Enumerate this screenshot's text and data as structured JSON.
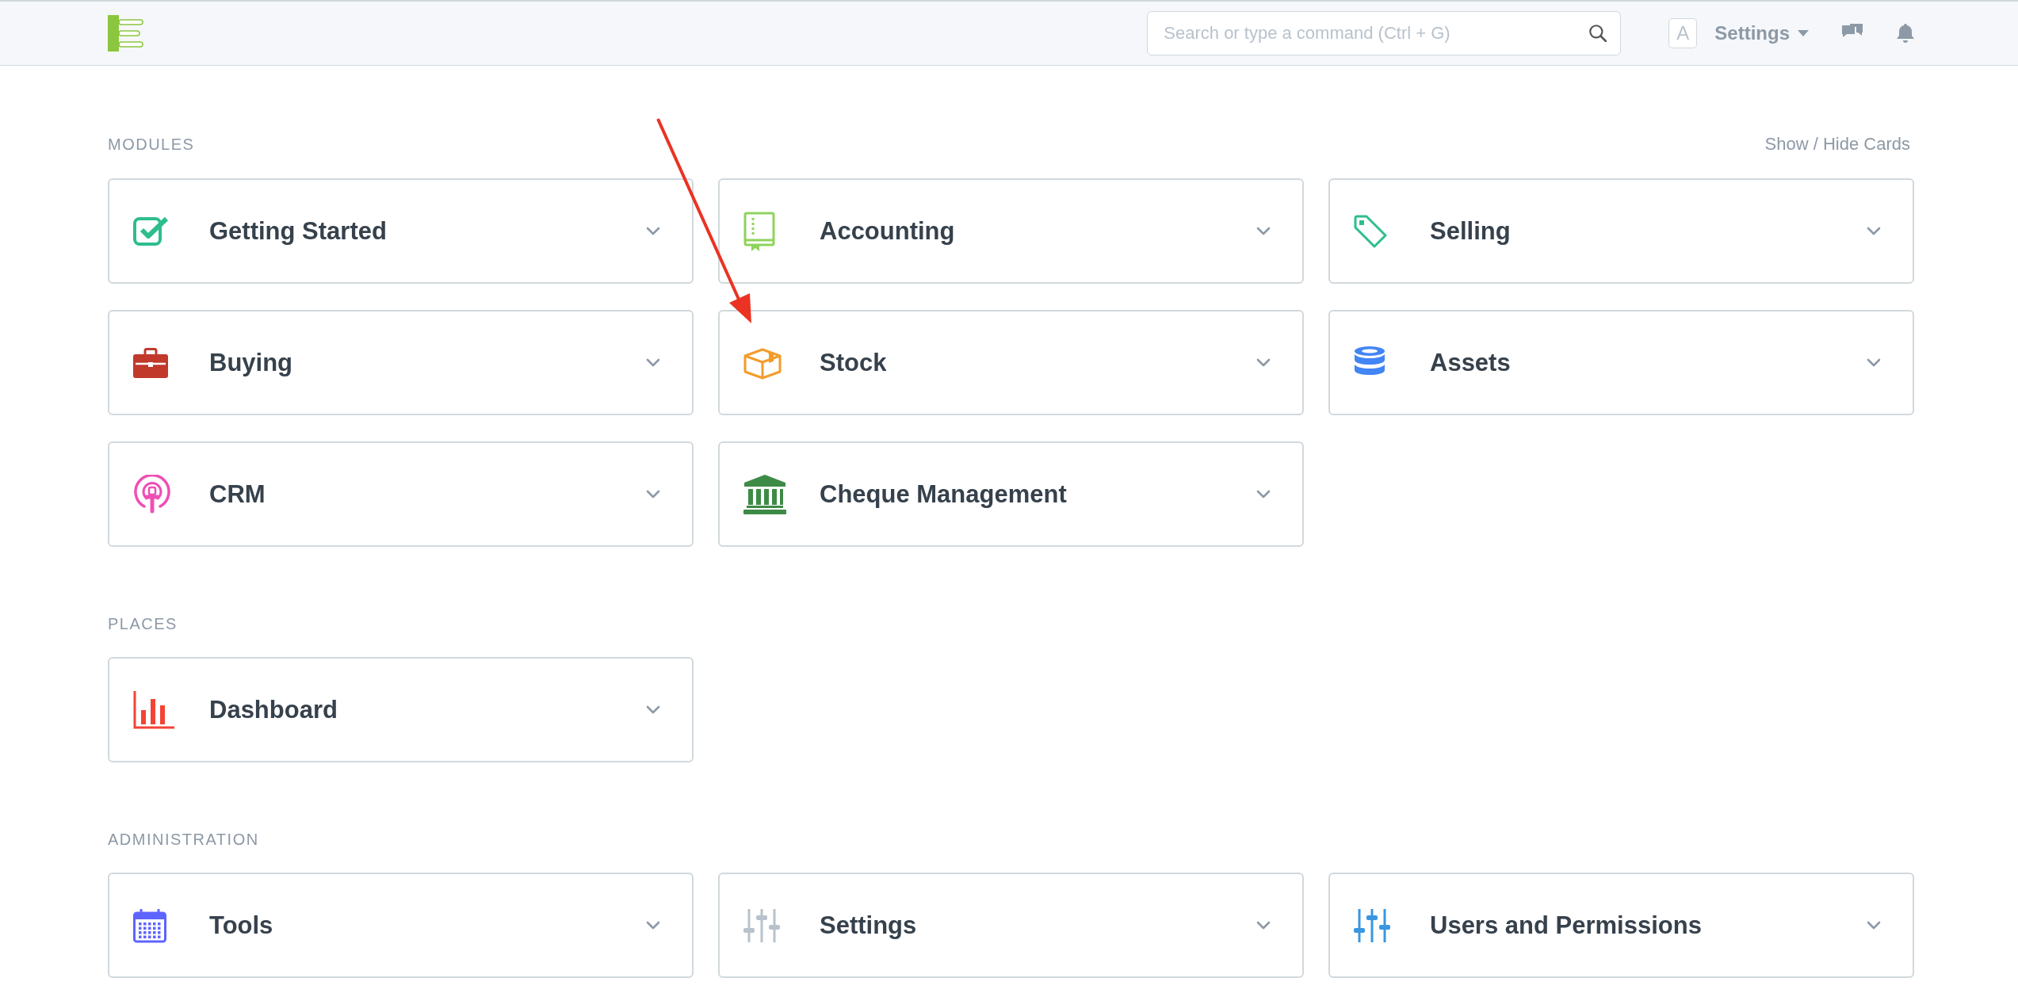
{
  "navbar": {
    "search": {
      "placeholder": "Search or type a command (Ctrl + G)"
    },
    "avatar": "A",
    "user_menu": "Settings"
  },
  "show_hide_cards": "Show / Hide Cards",
  "sections": [
    {
      "title": "MODULES",
      "cards": [
        {
          "label": "Getting Started",
          "kind": "checkbox",
          "color": "#2ebd8f"
        },
        {
          "label": "Accounting",
          "kind": "book",
          "color": "#8fd35e"
        },
        {
          "label": "Selling",
          "kind": "tag",
          "color": "#2ebd8f"
        },
        {
          "label": "Buying",
          "kind": "briefcase",
          "color": "#c0392b"
        },
        {
          "label": "Stock",
          "kind": "box",
          "color": "#f39c2c"
        },
        {
          "label": "Assets",
          "kind": "database",
          "color": "#4285f4"
        },
        {
          "label": "CRM",
          "kind": "podcast",
          "color": "#ef4fb5"
        },
        {
          "label": "Cheque Management",
          "kind": "bank",
          "color": "#3d8b46"
        }
      ]
    },
    {
      "title": "PLACES",
      "cards": [
        {
          "label": "Dashboard",
          "kind": "chart",
          "color": "#f44336"
        }
      ]
    },
    {
      "title": "ADMINISTRATION",
      "cards": [
        {
          "label": "Tools",
          "kind": "calendar",
          "color": "#5e64ff"
        },
        {
          "label": "Settings",
          "kind": "sliders",
          "color": "#b8c2cc"
        },
        {
          "label": "Users and Permissions",
          "kind": "sliders",
          "color": "#3a96e0"
        }
      ]
    }
  ]
}
